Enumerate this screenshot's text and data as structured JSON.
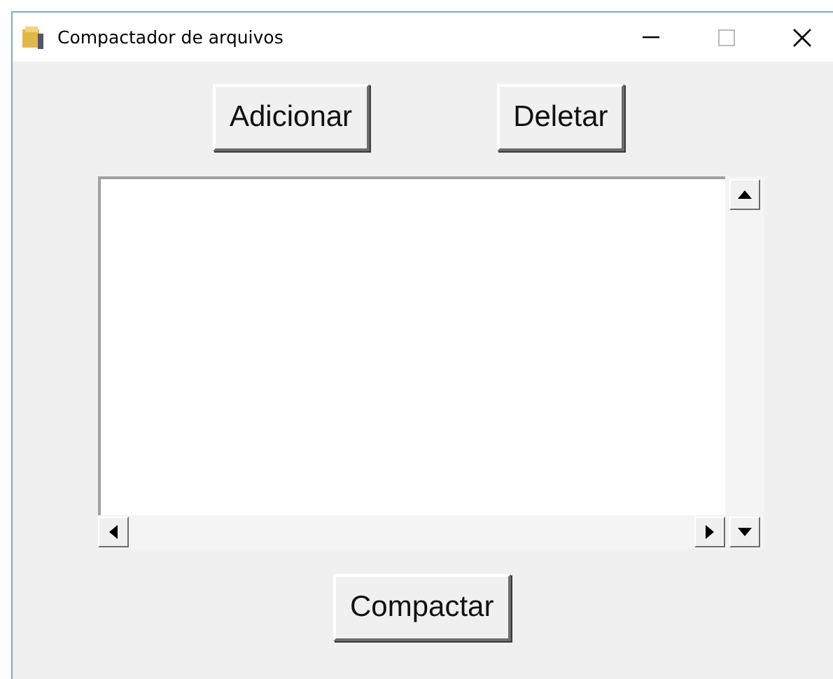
{
  "window": {
    "title": "Compactador de arquivos"
  },
  "buttons": [
    {
      "label": "Adicionar"
    },
    {
      "label": "Deletar"
    }
  ],
  "action_button": {
    "label": "Compactar"
  }
}
